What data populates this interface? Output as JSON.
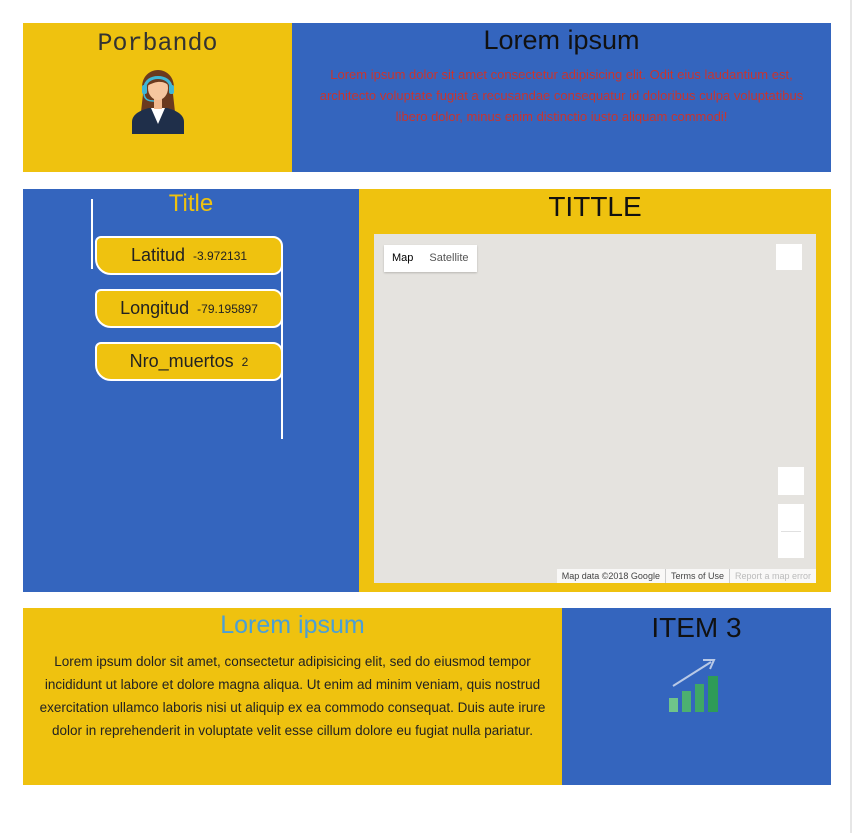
{
  "header": {
    "brand": "Porbando",
    "avatar_icon": "support-agent-icon",
    "hero_title": "Lorem ipsum",
    "hero_text": "Lorem ipsum dolor sit amet consectetur adipisicing elit. Odit eius laudantium est, architecto voluptate fugiat a recusandae consequatur id doloribus culpa voluptatibus libero dolor, minus enim distinctio iusto aliquam commodi!"
  },
  "info_panel": {
    "title": "Title",
    "items": [
      {
        "label": "Latitud",
        "value": "-3.972131"
      },
      {
        "label": "Longitud",
        "value": "-79.195897"
      },
      {
        "label": "Nro_muertos",
        "value": "2"
      }
    ]
  },
  "map_panel": {
    "title": "TITTLE",
    "map_types": [
      "Map",
      "Satellite"
    ],
    "selected_type": "Map",
    "attribution": "Map data ©2018 Google",
    "terms": "Terms of Use",
    "report": "Report a map error"
  },
  "footer": {
    "about_title": "Lorem ipsum",
    "about_text": "Lorem ipsum dolor sit amet, consectetur adipisicing elit, sed do eiusmod tempor incididunt ut labore et dolore magna aliqua. Ut enim ad minim veniam, quis nostrud exercitation ullamco laboris nisi ut aliquip ex ea commodo consequat. Duis aute irure dolor in reprehenderit in voluptate velit esse cillum dolore eu fugiat nulla pariatur.",
    "item3_title": "ITEM 3",
    "item3_icon": "growth-chart-icon"
  },
  "colors": {
    "yellow": "#efc20f",
    "blue": "#3465be",
    "hero_text": "#c73530",
    "about_title": "#4a9fd6"
  }
}
